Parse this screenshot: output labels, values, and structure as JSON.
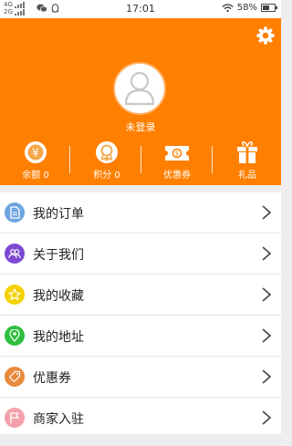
{
  "status_bar": {
    "net_top": "4G",
    "net_bottom": "2G",
    "time": "17:01",
    "battery": "58%",
    "battery_level": 0.58,
    "app_icons": [
      "wechat-icon",
      "qq-icon"
    ]
  },
  "header": {
    "background": "#ff7f00",
    "settings_icon": "gear-icon",
    "login_label": "未登录",
    "stats": [
      {
        "icon": "yen-coin-icon",
        "label": "余额 0"
      },
      {
        "icon": "points-medal-icon",
        "label": "积分 0"
      },
      {
        "icon": "coupon-ticket-icon",
        "label": "优惠券"
      },
      {
        "icon": "gift-icon",
        "label": "礼品"
      }
    ]
  },
  "menu": [
    {
      "label": "我的订单",
      "icon": "document-icon",
      "color": "#6ea4e0"
    },
    {
      "label": "关于我们",
      "icon": "people-icon",
      "color": "#7d49d3"
    },
    {
      "label": "我的收藏",
      "icon": "star-icon",
      "color": "#f4d200"
    },
    {
      "label": "我的地址",
      "icon": "location-pin-icon",
      "color": "#2fbf40"
    },
    {
      "label": "优惠券",
      "icon": "tag-icon",
      "color": "#e88a3c"
    },
    {
      "label": "商家入驻",
      "icon": "flag-icon",
      "color": "#f4a0ab"
    }
  ]
}
